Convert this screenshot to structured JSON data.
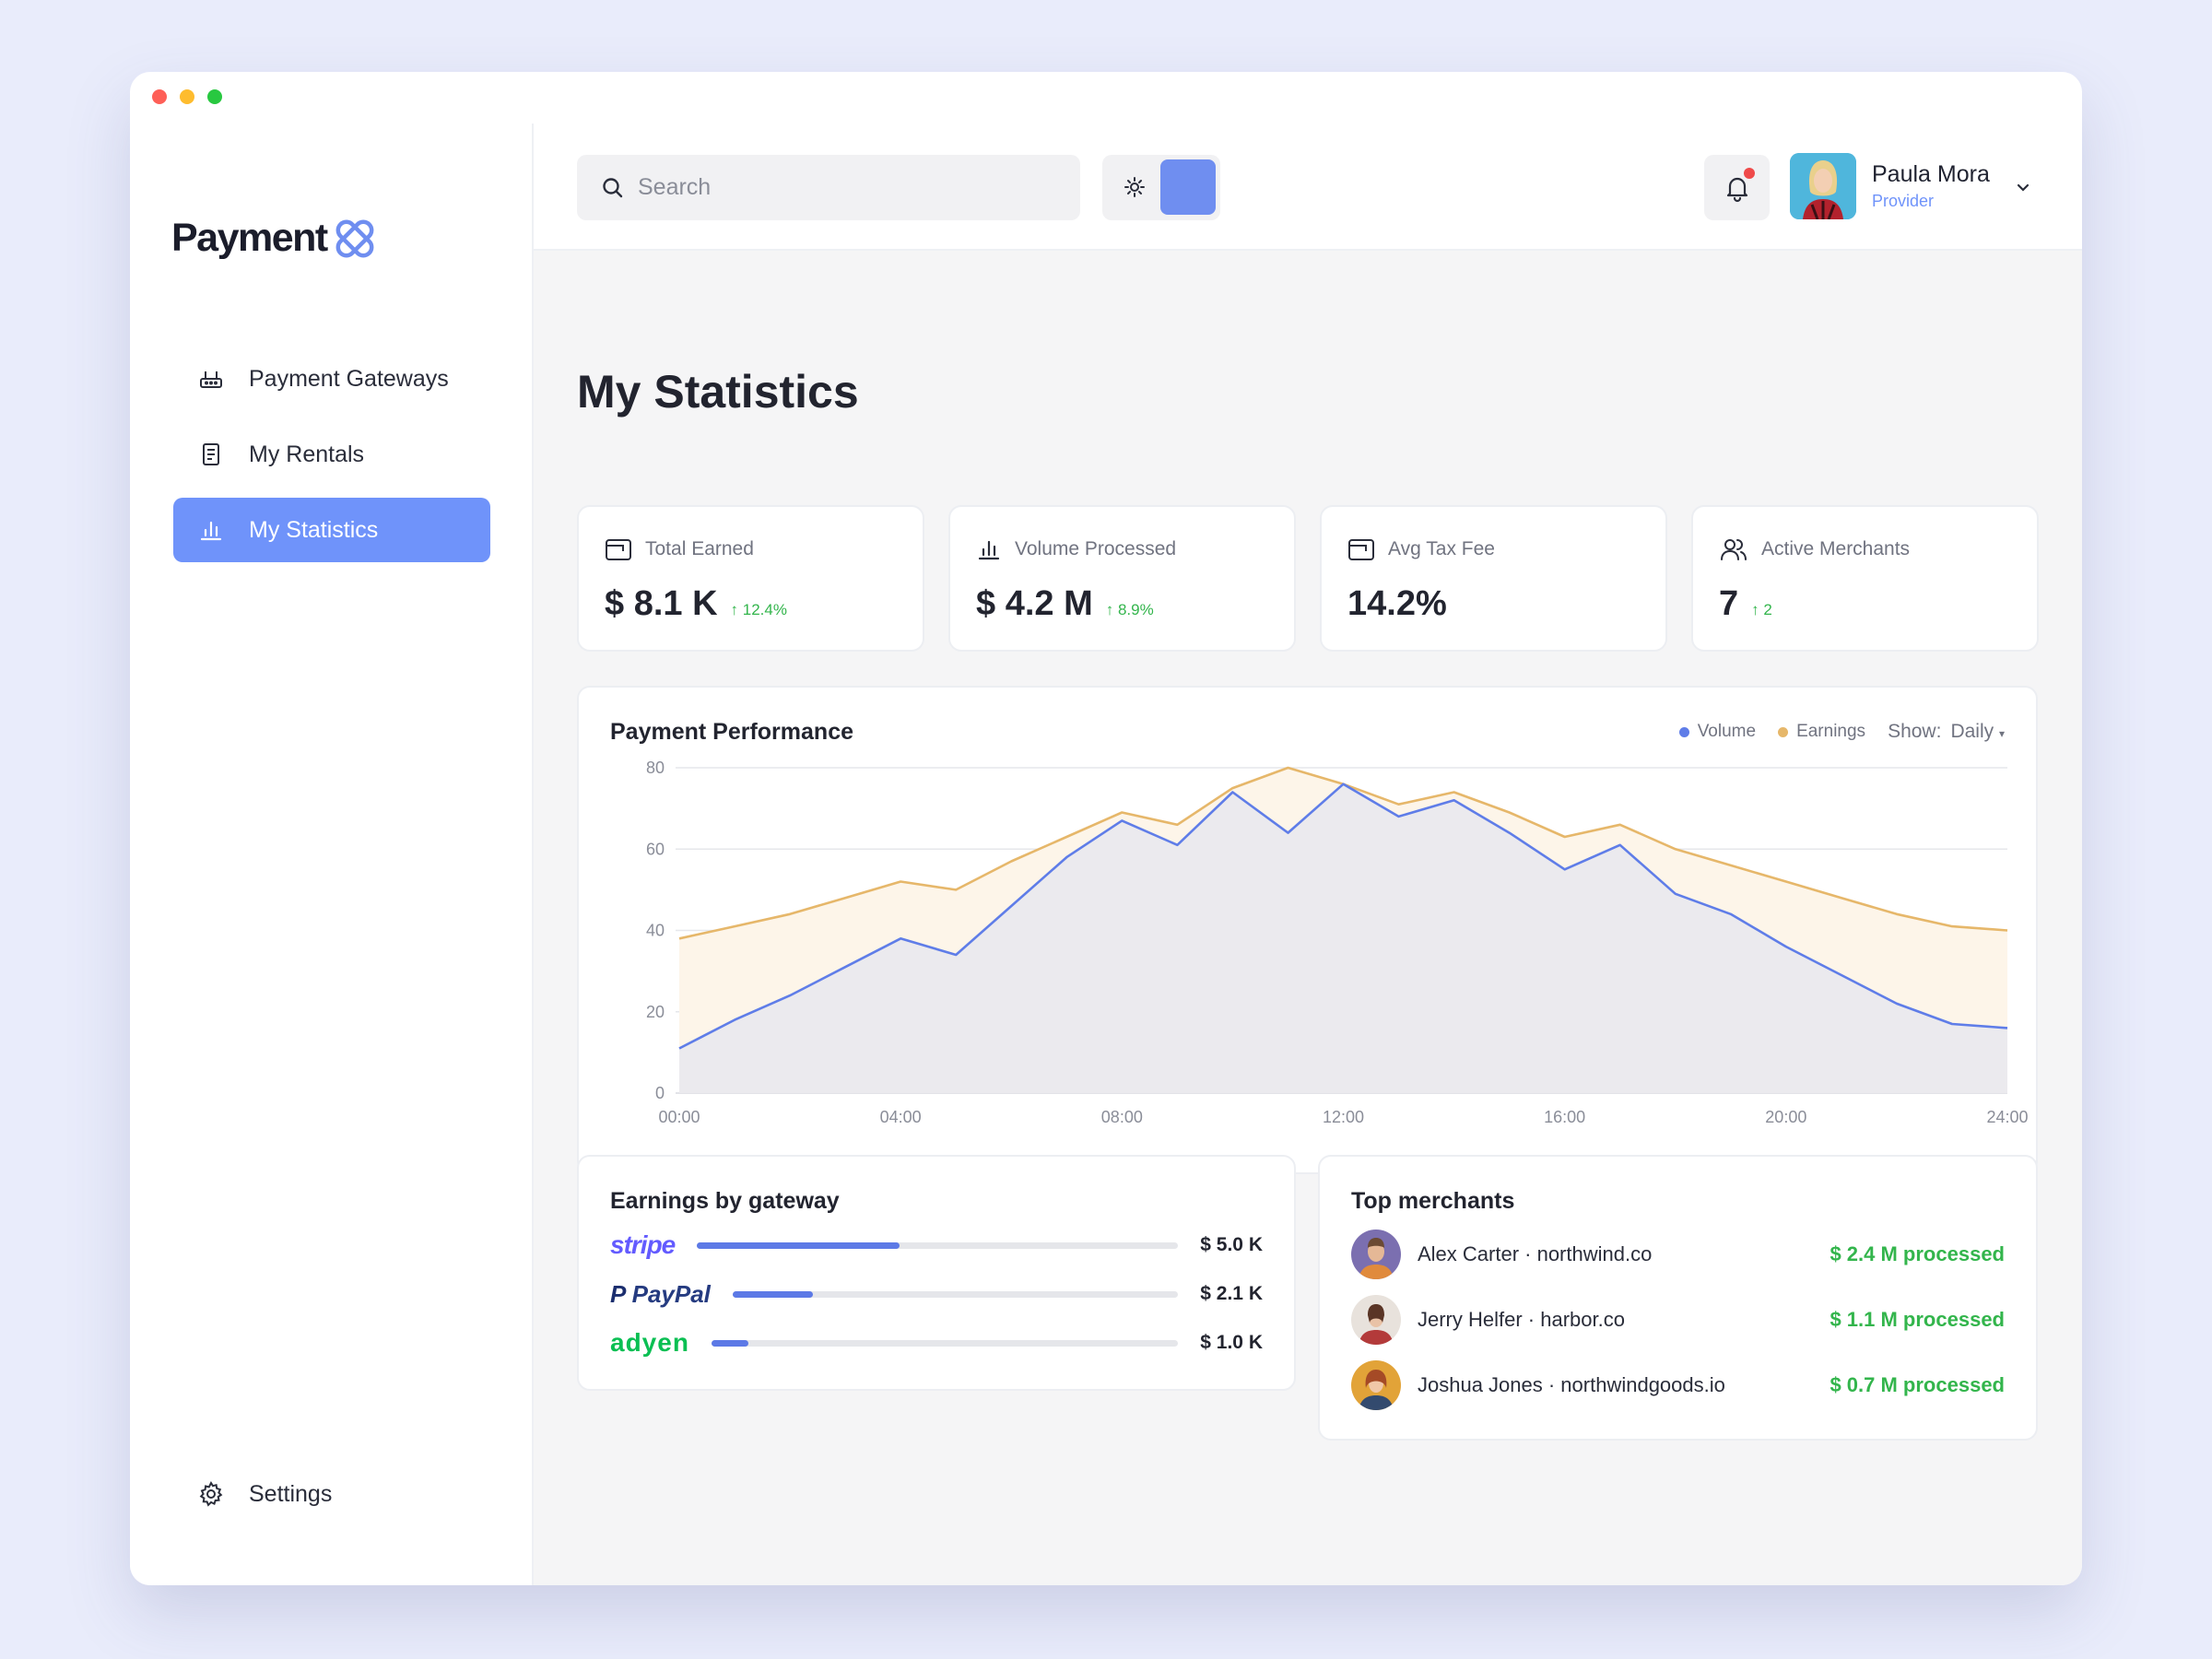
{
  "brand": {
    "name": "Payment"
  },
  "sidebar": {
    "items": [
      {
        "label": "Payment Gateways",
        "icon": "router-icon",
        "active": false
      },
      {
        "label": "My Rentals",
        "icon": "document-icon",
        "active": false
      },
      {
        "label": "My Statistics",
        "icon": "bar-chart-icon",
        "active": true
      }
    ],
    "settings_label": "Settings"
  },
  "topbar": {
    "search_placeholder": "Search",
    "user": {
      "name": "Paula Mora",
      "role": "Provider"
    }
  },
  "page": {
    "title": "My Statistics"
  },
  "kpis": [
    {
      "label": "Total Earned",
      "value": "$ 8.1 K",
      "delta": "↑ 12.4%",
      "icon": "wallet-icon"
    },
    {
      "label": "Volume Processed",
      "value": "$ 4.2 M",
      "delta": "↑ 8.9%",
      "icon": "bar-chart-icon"
    },
    {
      "label": "Avg Tax Fee",
      "value": "14.2%",
      "delta": "",
      "icon": "wallet-icon"
    },
    {
      "label": "Active Merchants",
      "value": "7",
      "delta": "↑ 2",
      "icon": "users-icon"
    }
  ],
  "performance": {
    "title": "Payment Performance",
    "show_label": "Show:",
    "show_value": "Daily",
    "legend": [
      {
        "name": "Volume",
        "color": "#5f7de8"
      },
      {
        "name": "Earnings",
        "color": "#e6b76a"
      }
    ]
  },
  "chart_data": {
    "type": "area",
    "x": [
      0,
      1,
      2,
      3,
      4,
      5,
      6,
      7,
      8,
      9,
      10,
      11,
      12,
      13,
      14,
      15,
      16,
      17,
      18,
      19,
      20,
      21,
      22,
      23,
      24
    ],
    "xticks": [
      "00:00",
      "04:00",
      "08:00",
      "12:00",
      "16:00",
      "20:00",
      "24:00"
    ],
    "yticks": [
      0,
      20,
      40,
      60,
      80
    ],
    "ylim": [
      0,
      80
    ],
    "xlim": [
      0,
      24
    ],
    "grid": true,
    "legend_position": "top-right",
    "series": [
      {
        "name": "Earnings",
        "color": "#e6b76a",
        "fill": "#fdf5e9",
        "values": [
          38,
          41,
          44,
          48,
          52,
          50,
          57,
          63,
          69,
          66,
          75,
          80,
          76,
          71,
          74,
          69,
          63,
          66,
          60,
          56,
          52,
          48,
          44,
          41,
          40
        ]
      },
      {
        "name": "Volume",
        "color": "#5f7de8",
        "fill": "#ebeaee",
        "values": [
          11,
          18,
          24,
          31,
          38,
          34,
          46,
          58,
          67,
          61,
          74,
          64,
          76,
          68,
          72,
          64,
          55,
          61,
          49,
          44,
          36,
          29,
          22,
          17,
          16
        ]
      }
    ]
  },
  "gateways": {
    "title": "Earnings by gateway",
    "items": [
      {
        "name": "stripe",
        "color": "#635bff",
        "amount": "$ 5.0 K",
        "share": 0.42
      },
      {
        "name": "PayPal",
        "color": "#253b80",
        "amount": "$ 2.1 K",
        "share": 0.18
      },
      {
        "name": "adyen",
        "color": "#0abf53",
        "amount": "$ 1.0 K",
        "share": 0.08
      }
    ]
  },
  "merchants": {
    "title": "Top merchants",
    "items": [
      {
        "name": "Alex Carter · northwind.co",
        "amount": "$ 2.4 M processed"
      },
      {
        "name": "Jerry Helfer · harbor.co",
        "amount": "$ 1.1 M processed"
      },
      {
        "name": "Joshua Jones · northwindgoods.io",
        "amount": "$ 0.7 M processed"
      }
    ]
  }
}
